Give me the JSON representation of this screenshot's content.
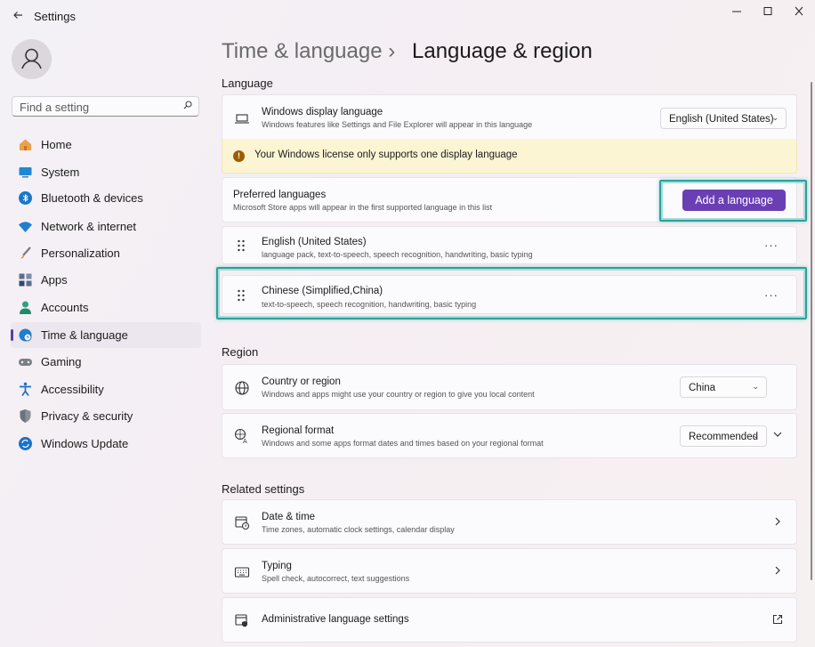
{
  "window": {
    "title": "Settings"
  },
  "search": {
    "placeholder": "Find a setting"
  },
  "sidebar": {
    "items": [
      {
        "label": "Home",
        "icon": "home-icon"
      },
      {
        "label": "System",
        "icon": "system-icon"
      },
      {
        "label": "Bluetooth & devices",
        "icon": "bluetooth-icon"
      },
      {
        "label": "Network & internet",
        "icon": "wifi-icon"
      },
      {
        "label": "Personalization",
        "icon": "brush-icon"
      },
      {
        "label": "Apps",
        "icon": "apps-icon"
      },
      {
        "label": "Accounts",
        "icon": "accounts-icon"
      },
      {
        "label": "Time & language",
        "icon": "globe-clock-icon",
        "active": true
      },
      {
        "label": "Gaming",
        "icon": "gamepad-icon"
      },
      {
        "label": "Accessibility",
        "icon": "accessibility-icon"
      },
      {
        "label": "Privacy & security",
        "icon": "shield-icon"
      },
      {
        "label": "Windows Update",
        "icon": "update-icon"
      }
    ]
  },
  "header": {
    "parent": "Time & language",
    "separator": "›",
    "current": "Language & region"
  },
  "language": {
    "heading": "Language",
    "display": {
      "title": "Windows display language",
      "subtitle": "Windows features like Settings and File Explorer will appear in this language",
      "value": "English (United States)"
    },
    "warning": "Your Windows license only supports one display language",
    "preferred": {
      "title": "Preferred languages",
      "subtitle": "Microsoft Store apps will appear in the first supported language in this list",
      "add_label": "Add a language"
    },
    "list": [
      {
        "name": "English (United States)",
        "features": "language pack, text-to-speech, speech recognition, handwriting, basic typing"
      },
      {
        "name": "Chinese (Simplified,China)",
        "features": "text-to-speech, speech recognition, handwriting, basic typing"
      }
    ]
  },
  "region": {
    "heading": "Region",
    "country": {
      "title": "Country or region",
      "subtitle": "Windows and apps might use your country or region to give you local content",
      "value": "China"
    },
    "format": {
      "title": "Regional format",
      "subtitle": "Windows and some apps format dates and times based on your regional format",
      "value": "Recommended"
    }
  },
  "related": {
    "heading": "Related settings",
    "items": [
      {
        "title": "Date & time",
        "subtitle": "Time zones, automatic clock settings, calendar display"
      },
      {
        "title": "Typing",
        "subtitle": "Spell check, autocorrect, text suggestions"
      },
      {
        "title": "Administrative language settings",
        "subtitle": ""
      }
    ]
  },
  "colors": {
    "accent": "#6a3fb4",
    "highlight": "#2f9f9c",
    "warning_bg": "#fbf5d4"
  }
}
